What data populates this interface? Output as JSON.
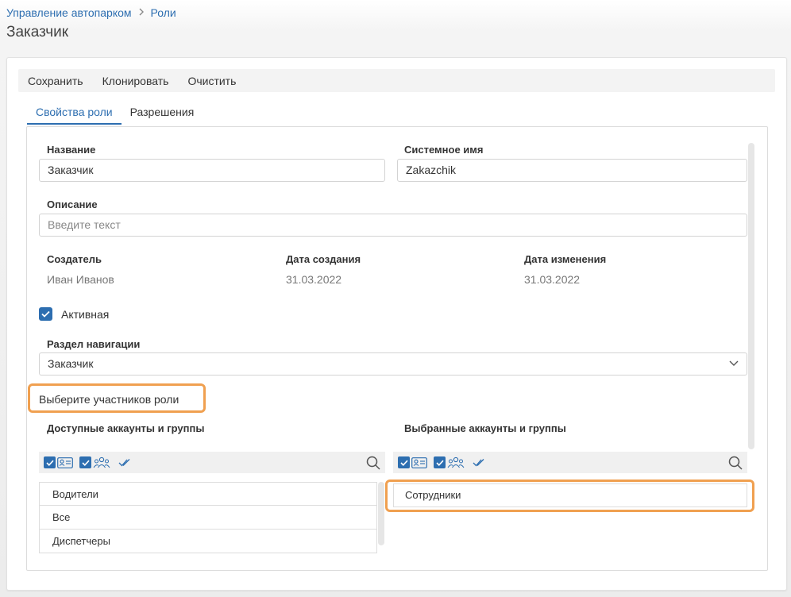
{
  "breadcrumb": {
    "root": "Управление автопарком",
    "current": "Роли"
  },
  "page_title": "Заказчик",
  "toolbar": {
    "save": "Сохранить",
    "clone": "Клонировать",
    "clear": "Очистить"
  },
  "tabs": [
    {
      "label": "Свойства роли"
    },
    {
      "label": "Разрешения"
    }
  ],
  "form": {
    "name_label": "Название",
    "name_value": "Заказчик",
    "system_name_label": "Системное имя",
    "system_name_value": "Zakazchik",
    "description_label": "Описание",
    "description_placeholder": "Введите текст",
    "creator_label": "Создатель",
    "creator_value": "Иван Иванов",
    "created_label": "Дата создания",
    "created_value": "31.03.2022",
    "modified_label": "Дата изменения",
    "modified_value": "31.03.2022",
    "active_label": "Активная",
    "active_checked": true,
    "nav_label": "Раздел навигации",
    "nav_value": "Заказчик"
  },
  "members": {
    "title": "Выберите участников роли",
    "available_label": "Доступные аккаунты и группы",
    "selected_label": "Выбранные аккаунты и группы",
    "available_items": [
      "Водители",
      "Все",
      "Диспетчеры"
    ],
    "selected_items": [
      "Сотрудники"
    ]
  },
  "colors": {
    "accent": "#2d6eb0",
    "highlight": "#f0a050"
  },
  "icons": [
    "chevron-right-icon",
    "check-icon",
    "chevron-down-icon",
    "user-card-icon",
    "group-icon",
    "check-all-icon",
    "search-icon"
  ]
}
